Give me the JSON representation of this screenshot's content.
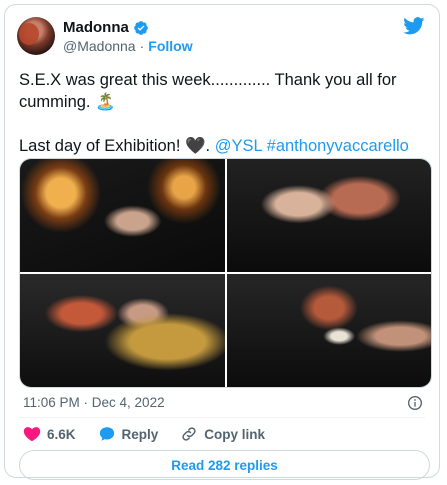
{
  "author": {
    "name": "Madonna",
    "handle": "@Madonna",
    "separator": "·",
    "follow_label": "Follow",
    "verified": true
  },
  "tweet": {
    "line1": "S.E.X was great this week............. Thank you all for cumming. 🏝️",
    "line2_text": "Last day of Exhibition! 🖤. ",
    "mention": "@YSL",
    "hashtag": "#anthonyvaccarello"
  },
  "media": {
    "count": 4
  },
  "meta": {
    "timestamp": "11:06 PM · Dec 4, 2022"
  },
  "actions": {
    "likes": "6.6K",
    "reply_label": "Reply",
    "copy_link_label": "Copy link"
  },
  "replies_button": "Read 282 replies",
  "colors": {
    "accent": "#1d9bf0",
    "like": "#f91880",
    "text": "#0f1419",
    "muted": "#536471",
    "border": "#cfd9de"
  }
}
